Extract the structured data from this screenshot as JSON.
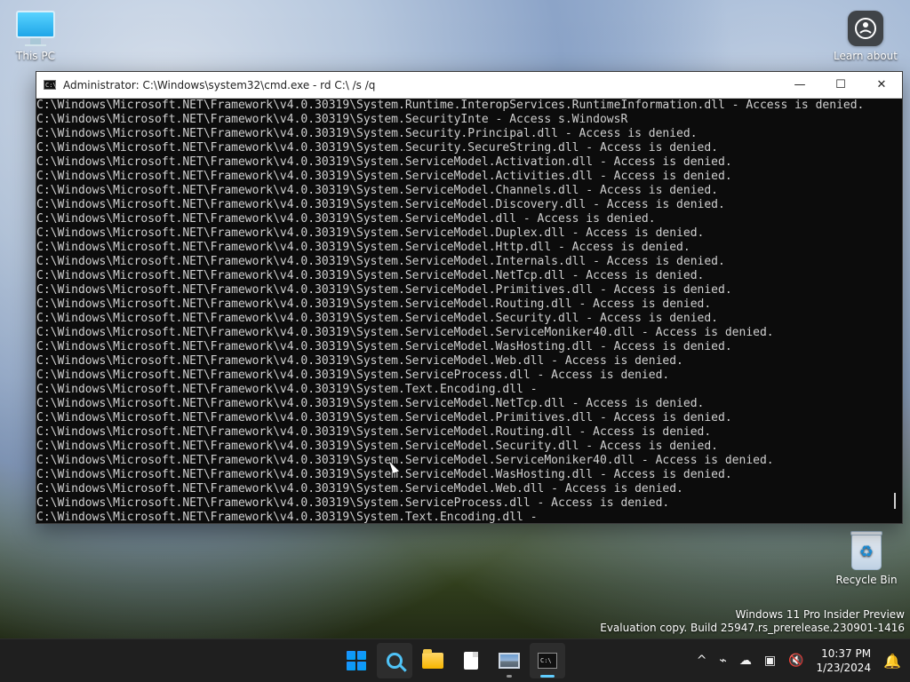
{
  "desktop": {
    "icons": [
      {
        "name": "this-pc",
        "label": "This PC"
      },
      {
        "name": "learn-about",
        "label": "Learn about"
      },
      {
        "name": "recycle-bin",
        "label": "Recycle Bin"
      }
    ]
  },
  "window": {
    "title": "Administrator: C:\\Windows\\system32\\cmd.exe - rd  C:\\ /s /q",
    "controls": {
      "minimize": "—",
      "maximize": "☐",
      "close": "✕"
    },
    "lines": [
      "C:\\Windows\\Microsoft.NET\\Framework\\v4.0.30319\\System.Runtime.InteropServices.RuntimeInformation.dll - Access is denied.",
      "C:\\Windows\\Microsoft.NET\\Framework\\v4.0.30319\\System.SecurityInte - Access s.WindowsR",
      "C:\\Windows\\Microsoft.NET\\Framework\\v4.0.30319\\System.Security.Principal.dll - Access is denied.",
      "C:\\Windows\\Microsoft.NET\\Framework\\v4.0.30319\\System.Security.SecureString.dll - Access is denied.",
      "C:\\Windows\\Microsoft.NET\\Framework\\v4.0.30319\\System.ServiceModel.Activation.dll - Access is denied.",
      "C:\\Windows\\Microsoft.NET\\Framework\\v4.0.30319\\System.ServiceModel.Activities.dll - Access is denied.",
      "C:\\Windows\\Microsoft.NET\\Framework\\v4.0.30319\\System.ServiceModel.Channels.dll - Access is denied.",
      "C:\\Windows\\Microsoft.NET\\Framework\\v4.0.30319\\System.ServiceModel.Discovery.dll - Access is denied.",
      "C:\\Windows\\Microsoft.NET\\Framework\\v4.0.30319\\System.ServiceModel.dll - Access is denied.",
      "C:\\Windows\\Microsoft.NET\\Framework\\v4.0.30319\\System.ServiceModel.Duplex.dll - Access is denied.",
      "C:\\Windows\\Microsoft.NET\\Framework\\v4.0.30319\\System.ServiceModel.Http.dll - Access is denied.",
      "C:\\Windows\\Microsoft.NET\\Framework\\v4.0.30319\\System.ServiceModel.Internals.dll - Access is denied.",
      "C:\\Windows\\Microsoft.NET\\Framework\\v4.0.30319\\System.ServiceModel.NetTcp.dll - Access is denied.",
      "C:\\Windows\\Microsoft.NET\\Framework\\v4.0.30319\\System.ServiceModel.Primitives.dll - Access is denied.",
      "C:\\Windows\\Microsoft.NET\\Framework\\v4.0.30319\\System.ServiceModel.Routing.dll - Access is denied.",
      "C:\\Windows\\Microsoft.NET\\Framework\\v4.0.30319\\System.ServiceModel.Security.dll - Access is denied.",
      "C:\\Windows\\Microsoft.NET\\Framework\\v4.0.30319\\System.ServiceModel.ServiceMoniker40.dll - Access is denied.",
      "C:\\Windows\\Microsoft.NET\\Framework\\v4.0.30319\\System.ServiceModel.WasHosting.dll - Access is denied.",
      "C:\\Windows\\Microsoft.NET\\Framework\\v4.0.30319\\System.ServiceModel.Web.dll - Access is denied.",
      "C:\\Windows\\Microsoft.NET\\Framework\\v4.0.30319\\System.ServiceProcess.dll - Access is denied.",
      "C:\\Windows\\Microsoft.NET\\Framework\\v4.0.30319\\System.Text.Encoding.dll -",
      "C:\\Windows\\Microsoft.NET\\Framework\\v4.0.30319\\System.ServiceModel.NetTcp.dll - Access is denied.",
      "C:\\Windows\\Microsoft.NET\\Framework\\v4.0.30319\\System.ServiceModel.Primitives.dll - Access is denied.",
      "C:\\Windows\\Microsoft.NET\\Framework\\v4.0.30319\\System.ServiceModel.Routing.dll - Access is denied.",
      "C:\\Windows\\Microsoft.NET\\Framework\\v4.0.30319\\System.ServiceModel.Security.dll - Access is denied.",
      "C:\\Windows\\Microsoft.NET\\Framework\\v4.0.30319\\System.ServiceModel.ServiceMoniker40.dll - Access is denied.",
      "C:\\Windows\\Microsoft.NET\\Framework\\v4.0.30319\\System.ServiceModel.WasHosting.dll - Access is denied.",
      "C:\\Windows\\Microsoft.NET\\Framework\\v4.0.30319\\System.ServiceModel.Web.dll - Access is denied.",
      "C:\\Windows\\Microsoft.NET\\Framework\\v4.0.30319\\System.ServiceProcess.dll - Access is denied.",
      "C:\\Windows\\Microsoft.NET\\Framework\\v4.0.30319\\System.Text.Encoding.dll -"
    ]
  },
  "watermark": {
    "line1": "Windows 11 Pro Insider Preview",
    "line2": "Evaluation copy. Build 25947.rs_prerelease.230901-1416"
  },
  "taskbar": {
    "apps": [
      {
        "name": "start",
        "icon": "windows-start-icon"
      },
      {
        "name": "search",
        "icon": "search-icon"
      },
      {
        "name": "file-explorer",
        "icon": "folder-icon"
      },
      {
        "name": "notepad",
        "icon": "document-icon"
      },
      {
        "name": "photos",
        "icon": "image-icon"
      },
      {
        "name": "terminal",
        "icon": "terminal-icon"
      }
    ],
    "tray": {
      "chevron": "^",
      "network": "⌁",
      "onedrive": "☁",
      "display": "▣",
      "volume": "🔇",
      "time": "10:37 PM",
      "date": "1/23/2024",
      "notification": "🔔"
    }
  },
  "colors": {
    "window_bg": "#0c0c0c",
    "console_text": "#d0d0d0",
    "taskbar_bg": "#1f1f1f",
    "accent": "#60cdff"
  }
}
